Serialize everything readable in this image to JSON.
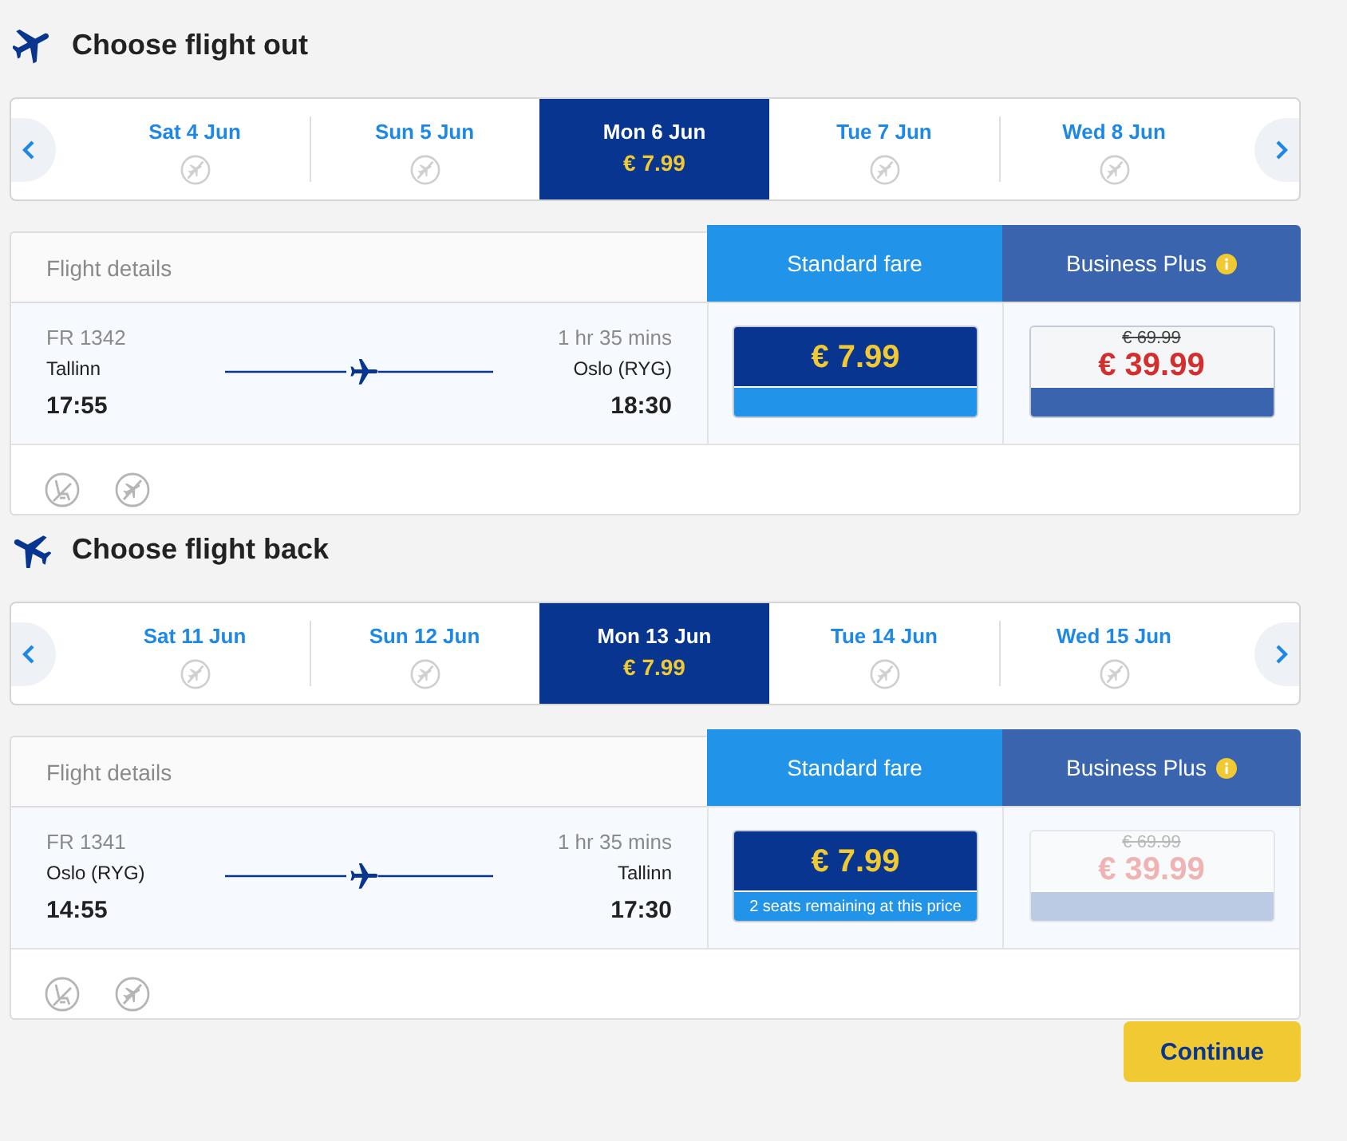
{
  "sections": [
    {
      "kind": "out",
      "title": "Choose flight out",
      "dates": [
        {
          "label": "Sat 4 Jun",
          "selected": false
        },
        {
          "label": "Sun 5 Jun",
          "selected": false
        },
        {
          "label": "Mon 6 Jun",
          "price": "€ 7.99",
          "selected": true
        },
        {
          "label": "Tue 7 Jun",
          "selected": false
        },
        {
          "label": "Wed 8 Jun",
          "selected": false
        }
      ],
      "flight": {
        "header": "Flight details",
        "number": "FR 1342",
        "duration": "1 hr 35 mins",
        "origin": "Tallinn",
        "destination": "Oslo (RYG)",
        "departure": "17:55",
        "arrival": "18:30"
      },
      "fares": [
        {
          "kind": "standard",
          "name": "Standard fare",
          "info": false,
          "price": "€ 7.99",
          "selected": true,
          "disabled": false
        },
        {
          "kind": "business",
          "name": "Business Plus",
          "info": true,
          "old_price": "€ 69.99",
          "price": "€ 39.99",
          "selected": false,
          "disabled": false
        }
      ]
    },
    {
      "kind": "back",
      "title": "Choose flight back",
      "dates": [
        {
          "label": "Sat 11 Jun",
          "selected": false
        },
        {
          "label": "Sun 12 Jun",
          "selected": false
        },
        {
          "label": "Mon 13 Jun",
          "price": "€ 7.99",
          "selected": true
        },
        {
          "label": "Tue 14 Jun",
          "selected": false
        },
        {
          "label": "Wed 15 Jun",
          "selected": false
        }
      ],
      "flight": {
        "header": "Flight details",
        "number": "FR 1341",
        "duration": "1 hr 35 mins",
        "origin": "Oslo (RYG)",
        "destination": "Tallinn",
        "departure": "14:55",
        "arrival": "17:30"
      },
      "fares": [
        {
          "kind": "standard",
          "name": "Standard fare",
          "info": false,
          "price": "€ 7.99",
          "note": "2 seats remaining at this price",
          "selected": true,
          "disabled": false
        },
        {
          "kind": "business",
          "name": "Business Plus",
          "info": true,
          "old_price": "€ 69.99",
          "price": "€ 39.99",
          "selected": false,
          "disabled": true
        }
      ]
    }
  ],
  "continue_button": "Continue"
}
